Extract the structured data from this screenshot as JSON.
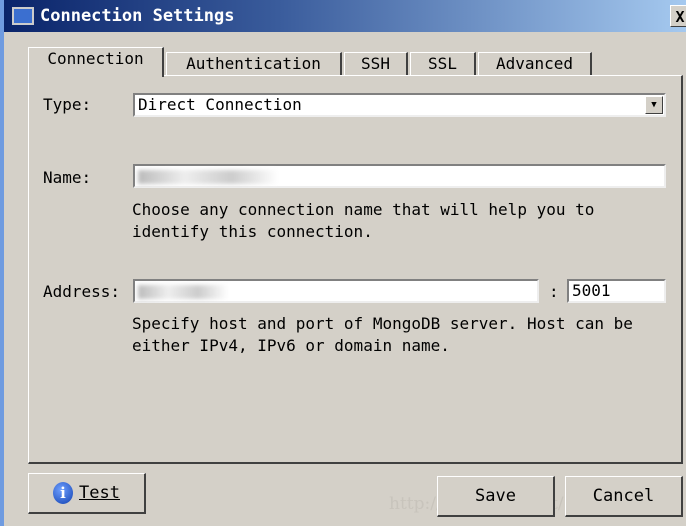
{
  "window": {
    "title": "Connection Settings",
    "close_label": "X"
  },
  "tabs": [
    {
      "label": "Connection",
      "active": true
    },
    {
      "label": "Authentication"
    },
    {
      "label": "SSH"
    },
    {
      "label": "SSL"
    },
    {
      "label": "Advanced"
    }
  ],
  "connection": {
    "type_label": "Type:",
    "type_value": "Direct Connection",
    "name_label": "Name:",
    "name_help_1": "Choose any connection name that will help you to",
    "name_help_2": "identify this connection.",
    "address_label": "Address:",
    "colon": ":",
    "port_value": "5001",
    "address_help_1": "Specify host and port of MongoDB server. Host can be",
    "address_help_2": "either IPv4, IPv6 or domain name."
  },
  "buttons": {
    "test": "Test",
    "save": "Save",
    "cancel": "Cancel"
  },
  "watermark": "http://blog.csdn.net/"
}
